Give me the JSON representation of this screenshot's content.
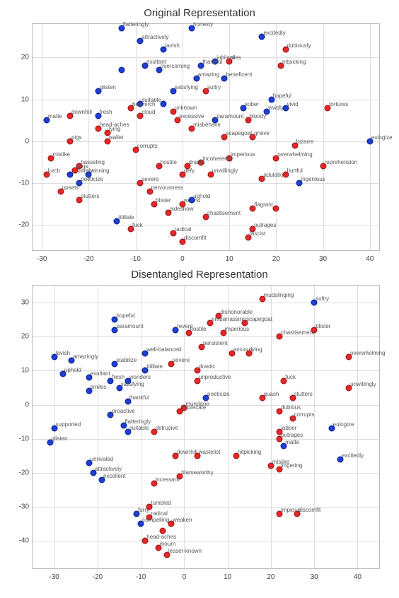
{
  "chart_data": [
    {
      "type": "scatter",
      "title": "Original Representation",
      "xlabel": "",
      "ylabel": "",
      "xlim": [
        -32,
        42
      ],
      "ylim": [
        -26,
        28
      ],
      "xticks": [
        -30,
        -20,
        -10,
        0,
        10,
        20,
        30,
        40
      ],
      "yticks": [
        -20,
        -10,
        0,
        10,
        20
      ],
      "points": [
        {
          "x": -13,
          "y": 27,
          "label": "flatteringly",
          "c": "blue"
        },
        {
          "x": -9,
          "y": 24,
          "label": "attractively",
          "c": "blue"
        },
        {
          "x": 2,
          "y": 27,
          "label": "honesty",
          "c": "blue"
        },
        {
          "x": -4,
          "y": 22,
          "label": "lavish",
          "c": "blue"
        },
        {
          "x": 17,
          "y": 25,
          "label": "excitedly",
          "c": "blue"
        },
        {
          "x": -8,
          "y": 18,
          "label": "exultant",
          "c": "blue"
        },
        {
          "x": 22,
          "y": 22,
          "label": "dubiously",
          "c": "red"
        },
        {
          "x": -5,
          "y": 17,
          "label": "overcoming",
          "c": "blue"
        },
        {
          "x": 7,
          "y": 19,
          "label": "jubilant",
          "c": "blue"
        },
        {
          "x": 10,
          "y": 19,
          "label": "riles",
          "c": "red"
        },
        {
          "x": 21,
          "y": 18,
          "label": "nitpicking",
          "c": "red"
        },
        {
          "x": 4,
          "y": 18,
          "label": "thankful",
          "c": "blue"
        },
        {
          "x": -13,
          "y": 17,
          "label": "",
          "c": "blue"
        },
        {
          "x": 3,
          "y": 15,
          "label": "amazing",
          "c": "blue"
        },
        {
          "x": 9,
          "y": 15,
          "label": "beneficent",
          "c": "blue"
        },
        {
          "x": -18,
          "y": 12,
          "label": "glisten",
          "c": "blue"
        },
        {
          "x": -2,
          "y": 12,
          "label": "satisfying",
          "c": "blue"
        },
        {
          "x": 5,
          "y": 12,
          "label": "sultry",
          "c": "red"
        },
        {
          "x": -9,
          "y": 9,
          "label": "suitable",
          "c": "blue"
        },
        {
          "x": -4,
          "y": 9,
          "label": "",
          "c": "blue"
        },
        {
          "x": 19,
          "y": 10,
          "label": "hopeful",
          "c": "blue"
        },
        {
          "x": -11,
          "y": 8,
          "label": "besmirch",
          "c": "red"
        },
        {
          "x": -2,
          "y": 7,
          "label": "unknown",
          "c": "red"
        },
        {
          "x": 13,
          "y": 8,
          "label": "sober",
          "c": "blue"
        },
        {
          "x": 18,
          "y": 7,
          "label": "vividly",
          "c": "blue"
        },
        {
          "x": 22,
          "y": 8,
          "label": "vivid",
          "c": "blue"
        },
        {
          "x": 31,
          "y": 8,
          "label": "tortures",
          "c": "red"
        },
        {
          "x": -24,
          "y": 6,
          "label": "downhill",
          "c": "red"
        },
        {
          "x": -18,
          "y": 6,
          "label": "fresh",
          "c": "blue"
        },
        {
          "x": -9,
          "y": 6,
          "label": "cloud",
          "c": "red"
        },
        {
          "x": -29,
          "y": 5,
          "label": "matte",
          "c": "blue"
        },
        {
          "x": -1,
          "y": 5,
          "label": "excessive",
          "c": "red"
        },
        {
          "x": 7,
          "y": 5,
          "label": "paramount",
          "c": "blue"
        },
        {
          "x": 14,
          "y": 5,
          "label": "bloody",
          "c": "red"
        },
        {
          "x": -18,
          "y": 3,
          "label": "head-aches",
          "c": "red"
        },
        {
          "x": -16,
          "y": 2,
          "label": "lying",
          "c": "red"
        },
        {
          "x": 2,
          "y": 3,
          "label": "misbehave",
          "c": "red"
        },
        {
          "x": -24,
          "y": 0,
          "label": "pigs",
          "c": "red"
        },
        {
          "x": -16,
          "y": 0,
          "label": "wallet",
          "c": "red"
        },
        {
          "x": 9,
          "y": 1,
          "label": "scapegoat",
          "c": "red"
        },
        {
          "x": 15,
          "y": 1,
          "label": "grieve",
          "c": "red"
        },
        {
          "x": -10,
          "y": -2,
          "label": "corrupts",
          "c": "red"
        },
        {
          "x": 24,
          "y": -1,
          "label": "bizarre",
          "c": "red"
        },
        {
          "x": 40,
          "y": 0,
          "label": "eulogize",
          "c": "blue"
        },
        {
          "x": -28,
          "y": -4,
          "label": "mislike",
          "c": "red"
        },
        {
          "x": 10,
          "y": -4,
          "label": "imperious",
          "c": "red"
        },
        {
          "x": 4,
          "y": -5,
          "label": "incoherently",
          "c": "red"
        },
        {
          "x": 20,
          "y": -4,
          "label": "overwhelming",
          "c": "red"
        },
        {
          "x": -22,
          "y": -6,
          "label": "hasseling",
          "c": "red"
        },
        {
          "x": -5,
          "y": -6,
          "label": "hostile",
          "c": "red"
        },
        {
          "x": 1,
          "y": -6,
          "label": "drastic",
          "c": "red"
        },
        {
          "x": 30,
          "y": -6,
          "label": "reprehension",
          "c": "red"
        },
        {
          "x": -29,
          "y": -8,
          "label": "lurch",
          "c": "red"
        },
        {
          "x": -24,
          "y": -8,
          "label": "squarely",
          "c": "blue"
        },
        {
          "x": -20,
          "y": -8,
          "label": "winning",
          "c": "blue"
        },
        {
          "x": -23,
          "y": -7,
          "label": "sags",
          "c": "red"
        },
        {
          "x": 0,
          "y": -8,
          "label": "defy",
          "c": "red"
        },
        {
          "x": 6,
          "y": -8,
          "label": "unwillingly",
          "c": "red"
        },
        {
          "x": 17,
          "y": -9,
          "label": "adulation",
          "c": "red"
        },
        {
          "x": 22,
          "y": -8,
          "label": "hurtful",
          "c": "red"
        },
        {
          "x": -22,
          "y": -10,
          "label": "poeticize",
          "c": "blue"
        },
        {
          "x": -9,
          "y": -10,
          "label": "severe",
          "c": "red"
        },
        {
          "x": 25,
          "y": -10,
          "label": "ingenious",
          "c": "blue"
        },
        {
          "x": -26,
          "y": -12,
          "label": "upsets",
          "c": "red"
        },
        {
          "x": -7,
          "y": -12,
          "label": "nervousness",
          "c": "red"
        },
        {
          "x": -22,
          "y": -14,
          "label": "stutters",
          "c": "red"
        },
        {
          "x": -6,
          "y": -15,
          "label": "blister",
          "c": "red"
        },
        {
          "x": 0,
          "y": -15,
          "label": "wound",
          "c": "red"
        },
        {
          "x": 2,
          "y": -14,
          "label": "uphold",
          "c": "blue"
        },
        {
          "x": 15,
          "y": -16,
          "label": "flagrant",
          "c": "red"
        },
        {
          "x": 20,
          "y": -16,
          "label": "",
          "c": "red"
        },
        {
          "x": -3,
          "y": -17,
          "label": "sideshow",
          "c": "red"
        },
        {
          "x": 5,
          "y": -18,
          "label": "chastisement",
          "c": "red"
        },
        {
          "x": -14,
          "y": -19,
          "label": "titillate",
          "c": "blue"
        },
        {
          "x": -11,
          "y": -21,
          "label": "fuck",
          "c": "red"
        },
        {
          "x": 15,
          "y": -21,
          "label": "outrages",
          "c": "red"
        },
        {
          "x": -2,
          "y": -22,
          "label": "radical",
          "c": "red"
        },
        {
          "x": 14,
          "y": -23,
          "label": "fascist",
          "c": "red"
        },
        {
          "x": 0,
          "y": -24,
          "label": "discomfit",
          "c": "red"
        }
      ]
    },
    {
      "type": "scatter",
      "title": "Disentangled Representation",
      "xlabel": "",
      "ylabel": "",
      "xlim": [
        -35,
        45
      ],
      "ylim": [
        -48,
        35
      ],
      "xticks": [
        -30,
        -20,
        -10,
        0,
        10,
        20,
        30,
        40
      ],
      "yticks": [
        -40,
        -30,
        -20,
        -10,
        0,
        10,
        20,
        30
      ],
      "points": [
        {
          "x": 18,
          "y": 31,
          "label": "mudslinging",
          "c": "red"
        },
        {
          "x": 30,
          "y": 30,
          "label": "sultry",
          "c": "blue"
        },
        {
          "x": -16,
          "y": 25,
          "label": "hopeful",
          "c": "blue"
        },
        {
          "x": 8,
          "y": 26,
          "label": "dishonorable",
          "c": "red"
        },
        {
          "x": 6,
          "y": 24,
          "label": "embarrassing",
          "c": "red"
        },
        {
          "x": 14,
          "y": 24,
          "label": "scapegoat",
          "c": "red"
        },
        {
          "x": -16,
          "y": 22,
          "label": "paramount",
          "c": "blue"
        },
        {
          "x": 30,
          "y": 22,
          "label": "blister",
          "c": "red"
        },
        {
          "x": -2,
          "y": 22,
          "label": "revere",
          "c": "blue"
        },
        {
          "x": 1,
          "y": 21,
          "label": "hostile",
          "c": "red"
        },
        {
          "x": 9,
          "y": 21,
          "label": "imperious",
          "c": "red"
        },
        {
          "x": 22,
          "y": 20,
          "label": "chastisement",
          "c": "red"
        },
        {
          "x": 4,
          "y": 17,
          "label": "persistent",
          "c": "red"
        },
        {
          "x": -30,
          "y": 14,
          "label": "lavish",
          "c": "blue"
        },
        {
          "x": -9,
          "y": 15,
          "label": "well-balanced",
          "c": "blue"
        },
        {
          "x": 11,
          "y": 15,
          "label": "anxious",
          "c": "red"
        },
        {
          "x": 15,
          "y": 15,
          "label": "lying",
          "c": "red"
        },
        {
          "x": 38,
          "y": 14,
          "label": "overwhelming",
          "c": "red"
        },
        {
          "x": -26,
          "y": 13,
          "label": "amazingly",
          "c": "blue"
        },
        {
          "x": -16,
          "y": 12,
          "label": "stabilize",
          "c": "blue"
        },
        {
          "x": -3,
          "y": 12,
          "label": "severe",
          "c": "red"
        },
        {
          "x": -28,
          "y": 9,
          "label": "uphold",
          "c": "blue"
        },
        {
          "x": -9,
          "y": 10,
          "label": "titillate",
          "c": "blue"
        },
        {
          "x": 3,
          "y": 10,
          "label": "drastic",
          "c": "red"
        },
        {
          "x": -22,
          "y": 8,
          "label": "exultant",
          "c": "blue"
        },
        {
          "x": -17,
          "y": 7,
          "label": "fresh",
          "c": "blue"
        },
        {
          "x": -13,
          "y": 7,
          "label": "wonders",
          "c": "blue"
        },
        {
          "x": 3,
          "y": 7,
          "label": "unproductive",
          "c": "red"
        },
        {
          "x": 23,
          "y": 7,
          "label": "fuck",
          "c": "red"
        },
        {
          "x": -22,
          "y": 4,
          "label": "smiles",
          "c": "blue"
        },
        {
          "x": -15,
          "y": 5,
          "label": "satisfying",
          "c": "blue"
        },
        {
          "x": 38,
          "y": 5,
          "label": "unwillingly",
          "c": "red"
        },
        {
          "x": -13,
          "y": 1,
          "label": "thankful",
          "c": "blue"
        },
        {
          "x": 5,
          "y": 2,
          "label": "poeticize",
          "c": "blue"
        },
        {
          "x": 18,
          "y": 2,
          "label": "quash",
          "c": "red"
        },
        {
          "x": 25,
          "y": 2,
          "label": "stutters",
          "c": "red"
        },
        {
          "x": 0,
          "y": -1,
          "label": "mundane",
          "c": "red"
        },
        {
          "x": 22,
          "y": -2,
          "label": "dubious",
          "c": "red"
        },
        {
          "x": -17,
          "y": -3,
          "label": "proactive",
          "c": "blue"
        },
        {
          "x": -1,
          "y": -2,
          "label": "imprecate",
          "c": "red"
        },
        {
          "x": 25,
          "y": -4,
          "label": "corrupts",
          "c": "red"
        },
        {
          "x": -30,
          "y": -7,
          "label": "supported",
          "c": "blue"
        },
        {
          "x": -14,
          "y": -6,
          "label": "flatteringly",
          "c": "blue"
        },
        {
          "x": 34,
          "y": -7,
          "label": "eulogize",
          "c": "blue"
        },
        {
          "x": -13,
          "y": -8,
          "label": "suitable",
          "c": "blue"
        },
        {
          "x": -7,
          "y": -8,
          "label": "obtrusive",
          "c": "red"
        },
        {
          "x": 22,
          "y": -8,
          "label": "jabber",
          "c": "red"
        },
        {
          "x": -31,
          "y": -11,
          "label": "glisten",
          "c": "blue"
        },
        {
          "x": 22,
          "y": -10,
          "label": "outrages",
          "c": "red"
        },
        {
          "x": 23,
          "y": -12,
          "label": "matte",
          "c": "blue"
        },
        {
          "x": -2,
          "y": -15,
          "label": "downhill",
          "c": "red"
        },
        {
          "x": 3,
          "y": -15,
          "label": "wastelist",
          "c": "red"
        },
        {
          "x": 12,
          "y": -15,
          "label": "nitpicking",
          "c": "red"
        },
        {
          "x": 36,
          "y": -16,
          "label": "excitedly",
          "c": "blue"
        },
        {
          "x": -22,
          "y": -17,
          "label": "unrivaled",
          "c": "blue"
        },
        {
          "x": 20,
          "y": -18,
          "label": "mislike",
          "c": "red"
        },
        {
          "x": 22,
          "y": -19,
          "label": "lingering",
          "c": "red"
        },
        {
          "x": -21,
          "y": -20,
          "label": "attractively",
          "c": "blue"
        },
        {
          "x": -19,
          "y": -22,
          "label": "excellent",
          "c": "blue"
        },
        {
          "x": -1,
          "y": -21,
          "label": "blameworthy",
          "c": "red"
        },
        {
          "x": -7,
          "y": -23,
          "label": "incessant",
          "c": "red"
        },
        {
          "x": -8,
          "y": -30,
          "label": "tumbled",
          "c": "red"
        },
        {
          "x": -11,
          "y": -32,
          "label": "furry",
          "c": "blue"
        },
        {
          "x": 22,
          "y": -32,
          "label": "impious",
          "c": "red"
        },
        {
          "x": 26,
          "y": -32,
          "label": "discomfit",
          "c": "red"
        },
        {
          "x": -8,
          "y": -33,
          "label": "radical",
          "c": "red"
        },
        {
          "x": -10,
          "y": -35,
          "label": "compelling",
          "c": "blue"
        },
        {
          "x": -3,
          "y": -35,
          "label": "weaken",
          "c": "red"
        },
        {
          "x": -5,
          "y": -37,
          "label": "",
          "c": "red"
        },
        {
          "x": -9,
          "y": -40,
          "label": "head-aches",
          "c": "red"
        },
        {
          "x": -6,
          "y": -42,
          "label": "mourn",
          "c": "red"
        },
        {
          "x": -4,
          "y": -44,
          "label": "lesser-known",
          "c": "red"
        }
      ]
    }
  ]
}
